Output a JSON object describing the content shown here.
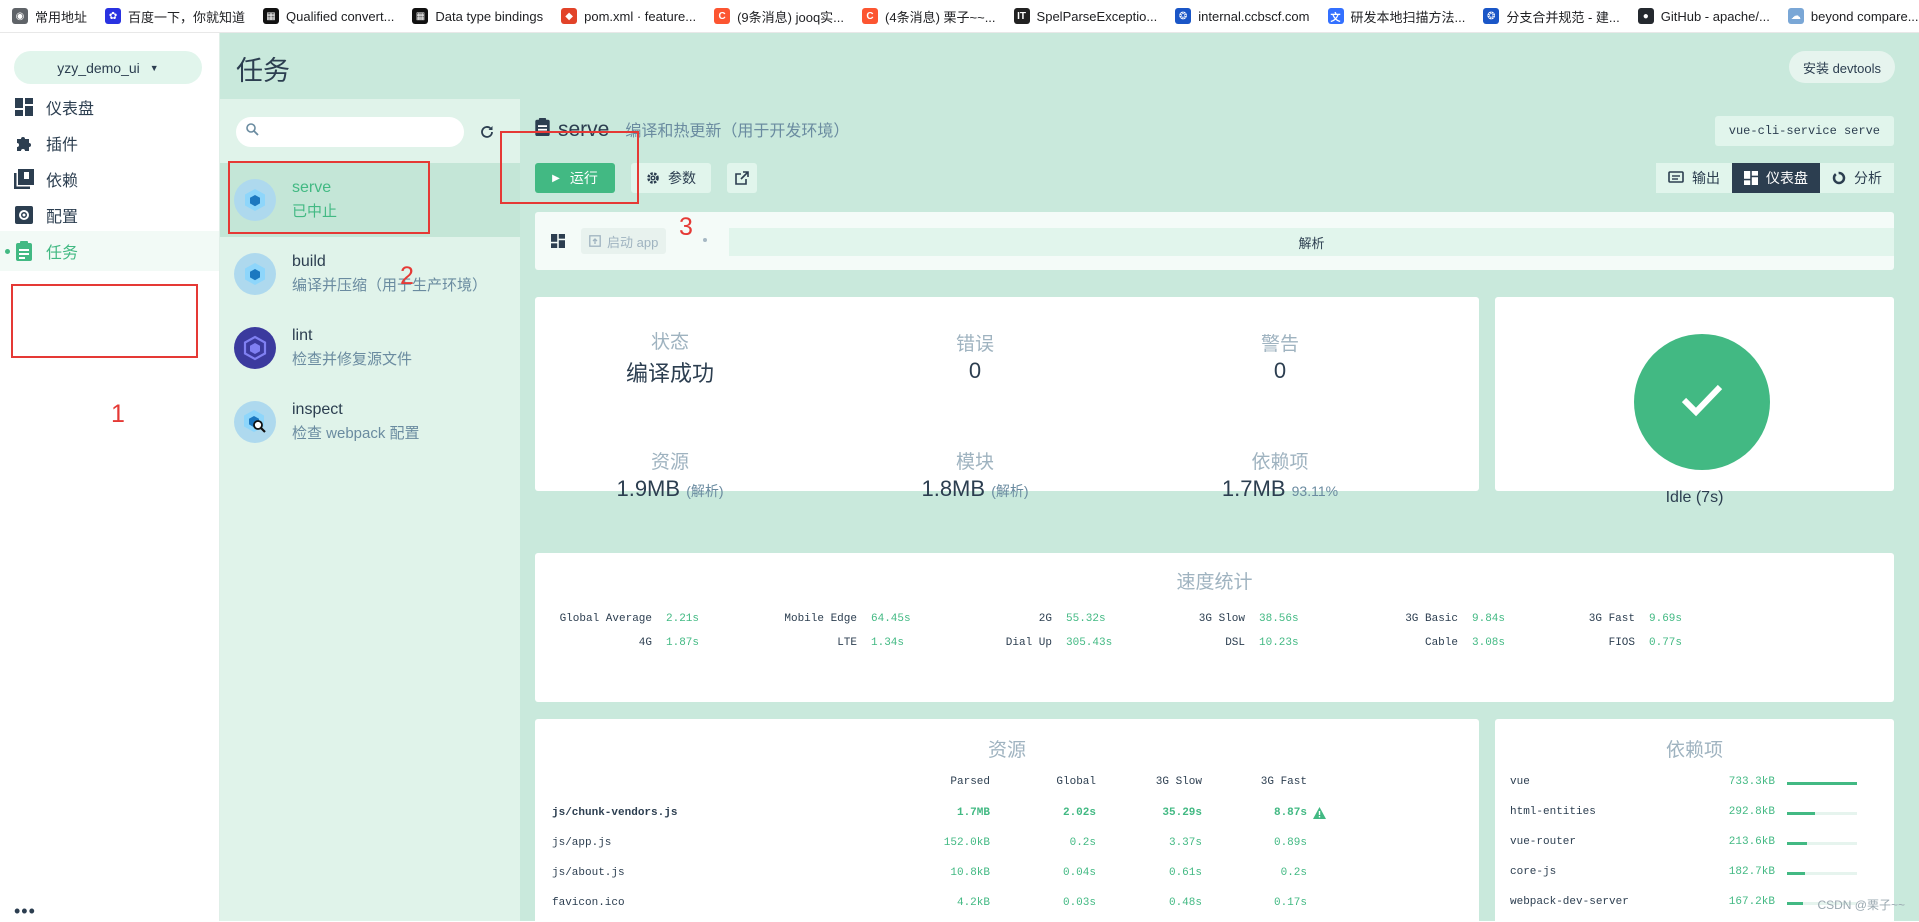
{
  "bookmarks": [
    {
      "label": "常用地址",
      "icon": "globe-icon",
      "color": "#5f6368"
    },
    {
      "label": "百度一下，你就知道",
      "icon": "baidu-icon",
      "color": "#2932e1"
    },
    {
      "label": "Qualified convert...",
      "icon": "jooq-icon",
      "color": "#111111"
    },
    {
      "label": "Data type bindings",
      "icon": "jooq-icon",
      "color": "#111111"
    },
    {
      "label": "pom.xml · feature...",
      "icon": "gitlab-icon",
      "color": "#e24329"
    },
    {
      "label": "(9条消息) jooq实...",
      "icon": "csdn-icon",
      "color": "#fc5531"
    },
    {
      "label": "(4条消息) 栗子~~...",
      "icon": "csdn-icon",
      "color": "#fc5531"
    },
    {
      "label": "SpelParseExceptio...",
      "icon": "it-icon",
      "color": "#222222"
    },
    {
      "label": "internal.ccbscf.com",
      "icon": "site-icon",
      "color": "#1a56c7"
    },
    {
      "label": "研发本地扫描方法...",
      "icon": "doc-icon",
      "color": "#3370ff"
    },
    {
      "label": "分支合并规范 - 建...",
      "icon": "site-icon",
      "color": "#1a56c7"
    },
    {
      "label": "GitHub - apache/...",
      "icon": "github-icon",
      "color": "#24292f"
    },
    {
      "label": "beyond compare...",
      "icon": "cloud-icon",
      "color": "#7aa7d6"
    }
  ],
  "project": {
    "name": "yzy_demo_ui"
  },
  "nav": [
    {
      "label": "仪表盘",
      "icon": "dashboard-icon"
    },
    {
      "label": "插件",
      "icon": "puzzle-icon"
    },
    {
      "label": "依赖",
      "icon": "library-icon"
    },
    {
      "label": "配置",
      "icon": "settings-icon"
    },
    {
      "label": "任务",
      "icon": "clipboard-icon",
      "active": true
    }
  ],
  "more": "•••",
  "header": {
    "title": "任务",
    "devtools": "安装 devtools"
  },
  "search": {
    "placeholder": ""
  },
  "tasks": [
    {
      "name": "serve",
      "desc": "已中止",
      "selected": true
    },
    {
      "name": "build",
      "desc": "编译并压缩（用于生产环境）"
    },
    {
      "name": "lint",
      "desc": "检查并修复源文件"
    },
    {
      "name": "inspect",
      "desc": "检查 webpack 配置"
    }
  ],
  "task_detail": {
    "title": "serve",
    "subtitle": "编译和热更新（用于开发环境）",
    "command": "vue-cli-service serve",
    "run": "运行",
    "params": "参数",
    "tabs": [
      "输出",
      "仪表盘",
      "分析"
    ],
    "active_tab": "仪表盘"
  },
  "build_bar": {
    "start": "启动 app",
    "analyze": "解析"
  },
  "stats": {
    "status_label": "状态",
    "status_value": "编译成功",
    "errors_label": "错误",
    "errors_value": "0",
    "warnings_label": "警告",
    "warnings_value": "0",
    "assets_label": "资源",
    "assets_value": "1.9MB",
    "assets_unit": "(解析)",
    "modules_label": "模块",
    "modules_value": "1.8MB",
    "modules_unit": "(解析)",
    "deps_label": "依赖项",
    "deps_value": "1.7MB",
    "deps_unit": "93.11%"
  },
  "idle": {
    "label": "Idle (7s)"
  },
  "speed": {
    "title": "速度统计",
    "rows": [
      [
        {
          "n": "Global Average",
          "v": "2.21s"
        },
        {
          "n": "Mobile Edge",
          "v": "64.45s"
        },
        {
          "n": "2G",
          "v": "55.32s"
        },
        {
          "n": "3G Slow",
          "v": "38.56s"
        },
        {
          "n": "3G Basic",
          "v": "9.84s"
        },
        {
          "n": "3G Fast",
          "v": "9.69s"
        }
      ],
      [
        {
          "n": "4G",
          "v": "1.87s"
        },
        {
          "n": "LTE",
          "v": "1.34s"
        },
        {
          "n": "Dial Up",
          "v": "305.43s"
        },
        {
          "n": "DSL",
          "v": "10.23s"
        },
        {
          "n": "Cable",
          "v": "3.08s"
        },
        {
          "n": "FIOS",
          "v": "0.77s"
        }
      ]
    ]
  },
  "assets": {
    "title": "资源",
    "columns": [
      "Parsed",
      "Global",
      "3G Slow",
      "3G Fast"
    ],
    "rows": [
      {
        "name": "js/chunk-vendors.js",
        "cells": [
          "1.7MB",
          "2.02s",
          "35.29s",
          "8.87s"
        ],
        "bold": true,
        "warning": true
      },
      {
        "name": "js/app.js",
        "cells": [
          "152.0kB",
          "0.2s",
          "3.37s",
          "0.89s"
        ]
      },
      {
        "name": "js/about.js",
        "cells": [
          "10.8kB",
          "0.04s",
          "0.61s",
          "0.2s"
        ]
      },
      {
        "name": "favicon.ico",
        "cells": [
          "4.2kB",
          "0.03s",
          "0.48s",
          "0.17s"
        ]
      }
    ]
  },
  "deps": {
    "title": "依赖项",
    "items": [
      {
        "name": "vue",
        "size": "733.3kB",
        "ratio": 1.0
      },
      {
        "name": "html-entities",
        "size": "292.8kB",
        "ratio": 0.4
      },
      {
        "name": "vue-router",
        "size": "213.6kB",
        "ratio": 0.29
      },
      {
        "name": "core-js",
        "size": "182.7kB",
        "ratio": 0.25
      },
      {
        "name": "webpack-dev-server",
        "size": "167.2kB",
        "ratio": 0.23
      }
    ]
  },
  "annotations": [
    "1",
    "2",
    "3"
  ],
  "watermark": "CSDN @栗子~~",
  "colors": {
    "accent": "#42b983",
    "dark": "#2c3e50",
    "panel": "#c9e9dc",
    "annotation": "#e53935"
  }
}
